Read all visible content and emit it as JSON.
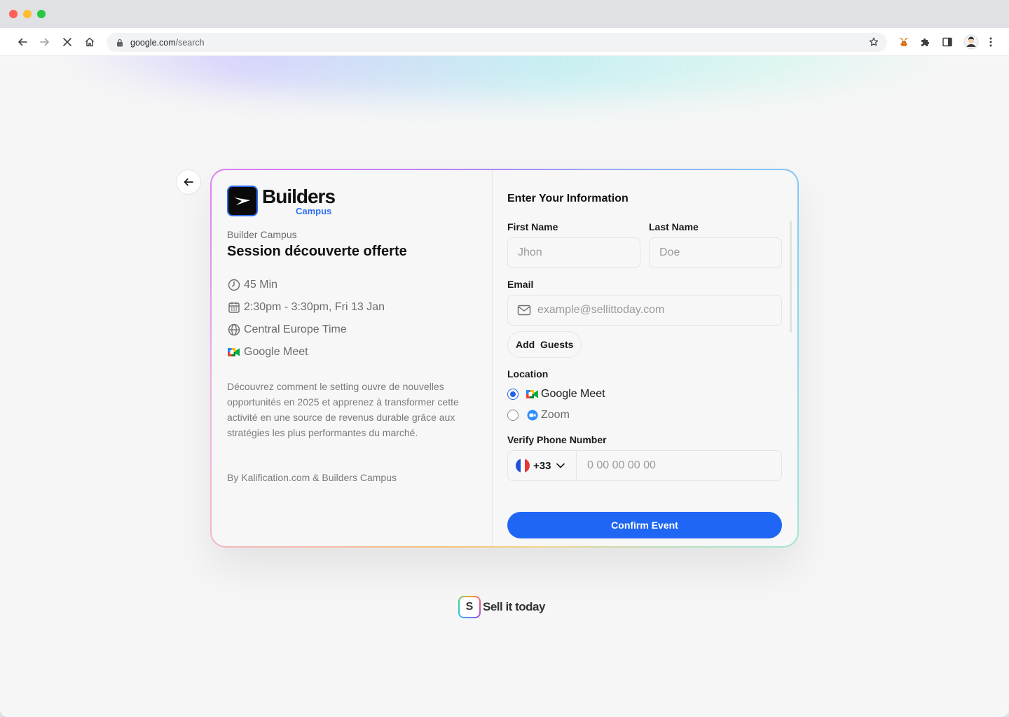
{
  "browser": {
    "url_domain": "google.com",
    "url_path": "/search"
  },
  "event": {
    "organizer": "Builder Campus",
    "title": "Session découverte offerte",
    "duration": "45 Min",
    "datetime": "2:30pm - 3:30pm, Fri 13 Jan",
    "timezone": "Central Europe Time",
    "platform": "Google Meet",
    "description": "Découvrez comment le setting ouvre de nouvelles opportunités en 2025 et apprenez à transformer cette activité en une source de revenus durable grâce aux stratégies les plus performantes du marché.",
    "byline": "By Kalification.com & Builders Campus"
  },
  "brand": {
    "name": "Builders",
    "sub": "Campus",
    "accent": "#2d6ef0"
  },
  "form": {
    "title": "Enter Your Information",
    "first_name_label": "First Name",
    "first_name_placeholder": "Jhon",
    "last_name_label": "Last Name",
    "last_name_placeholder": "Doe",
    "email_label": "Email",
    "email_placeholder": "example@sellittoday.com",
    "add_guests": "Add  Guests",
    "location_label": "Location",
    "location_options": [
      {
        "label": "Google Meet",
        "selected": true
      },
      {
        "label": "Zoom",
        "selected": false
      }
    ],
    "phone_label": "Verify Phone Number",
    "phone_country_code": "+33",
    "phone_placeholder": "0 00 00 00 00",
    "confirm_label": "Confirm Event",
    "primary_color": "#1f66f4"
  },
  "footer": {
    "logo_letter": "S",
    "brand": "Sell it today"
  }
}
